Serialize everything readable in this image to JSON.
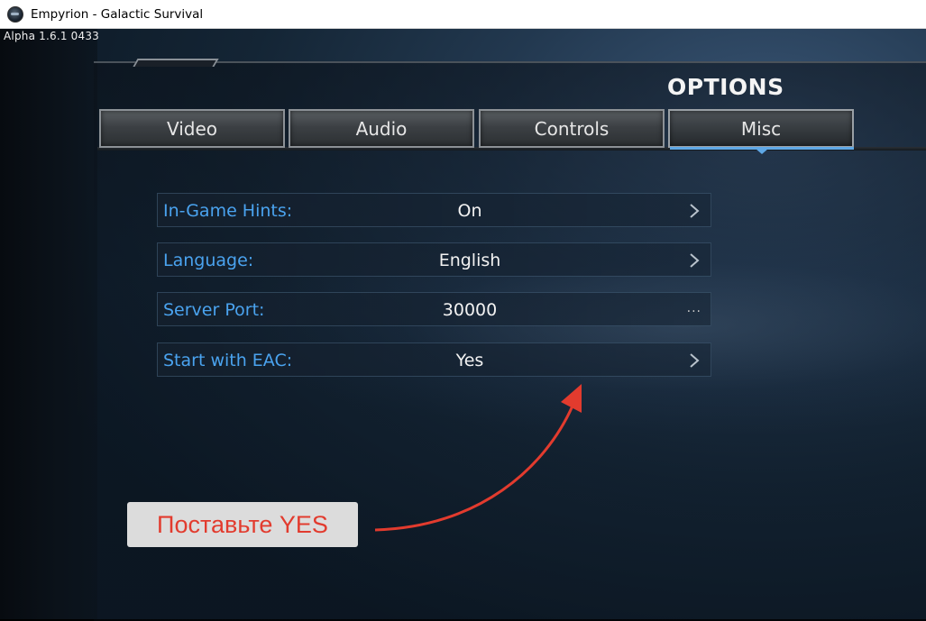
{
  "window": {
    "title": "Empyrion - Galactic Survival",
    "icon": "app-icon"
  },
  "version": "Alpha 1.6.1 0433",
  "options": {
    "title": "OPTIONS",
    "tabs": [
      {
        "label": "Video",
        "active": false
      },
      {
        "label": "Audio",
        "active": false
      },
      {
        "label": "Controls",
        "active": false
      },
      {
        "label": "Misc",
        "active": true
      }
    ],
    "settings": [
      {
        "label": "In-Game Hints:",
        "value": "On",
        "control": "chevron-right-icon"
      },
      {
        "label": "Language:",
        "value": "English",
        "control": "chevron-right-icon"
      },
      {
        "label": "Server Port:",
        "value": "30000",
        "control": "..."
      },
      {
        "label": "Start with EAC:",
        "value": "Yes",
        "control": "chevron-right-icon"
      }
    ]
  },
  "annotation": {
    "text": "Поставьте YES",
    "color": "#e23b2e"
  },
  "colors": {
    "label_blue": "#4aa3ef",
    "tab_active_underline": "#5fa8e6"
  }
}
